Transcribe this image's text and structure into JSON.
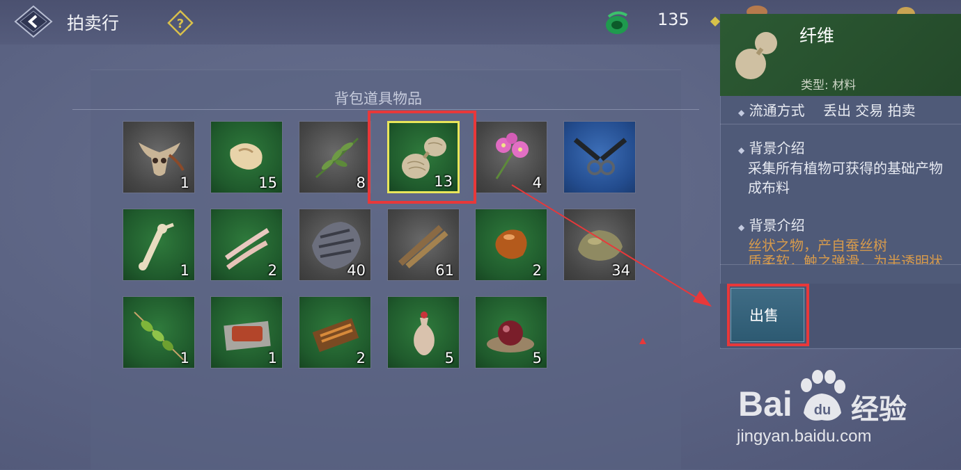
{
  "header": {
    "title": "拍卖行",
    "currency_value": "135"
  },
  "inventory": {
    "title": "背包道具物品",
    "slots": [
      {
        "icon": "ox-skull-icon",
        "count": "1"
      },
      {
        "icon": "ore-chunk-icon",
        "count": "15"
      },
      {
        "icon": "herb-leaf-icon",
        "count": "8"
      },
      {
        "icon": "fiber-icon",
        "count": "13"
      },
      {
        "icon": "pink-flower-icon",
        "count": "4"
      },
      {
        "icon": "scissors-icon",
        "count": ""
      },
      {
        "icon": "bone-icon",
        "count": "1"
      },
      {
        "icon": "ribs-icon",
        "count": "2"
      },
      {
        "icon": "hide-icon",
        "count": "40"
      },
      {
        "icon": "wood-plank-icon",
        "count": "61"
      },
      {
        "icon": "amber-icon",
        "count": "2"
      },
      {
        "icon": "stone-icon",
        "count": "34"
      },
      {
        "icon": "skewer-veg-icon",
        "count": "1"
      },
      {
        "icon": "meat-icon",
        "count": "1"
      },
      {
        "icon": "skewer-meat-icon",
        "count": "2"
      },
      {
        "icon": "vase-icon",
        "count": "5"
      },
      {
        "icon": "red-pearl-icon",
        "count": "5"
      }
    ]
  },
  "detail": {
    "name": "纤维",
    "type": "类型: 材料",
    "trade_label": "流通方式",
    "trade_value": "丢出 交易 拍卖",
    "bg1_title": "背景介绍",
    "bg1_text_1": "采集所有植物可获得的基础产物",
    "bg1_text_2": "成布料",
    "bg2_title": "背景介绍",
    "bg2_text_1": "丝状之物，产自蚕丝树",
    "bg2_text_2": "质柔软，触之弹滑，为半透明状",
    "sell_label": "出售"
  },
  "watermark": {
    "brand": "Bai",
    "paw_text": "du",
    "cn": "经验",
    "url": "jingyan.baidu.com"
  },
  "colors": {
    "highlight": "#e8383a",
    "selected_border": "#e9e65a",
    "orange_text": "#d69a4c"
  }
}
